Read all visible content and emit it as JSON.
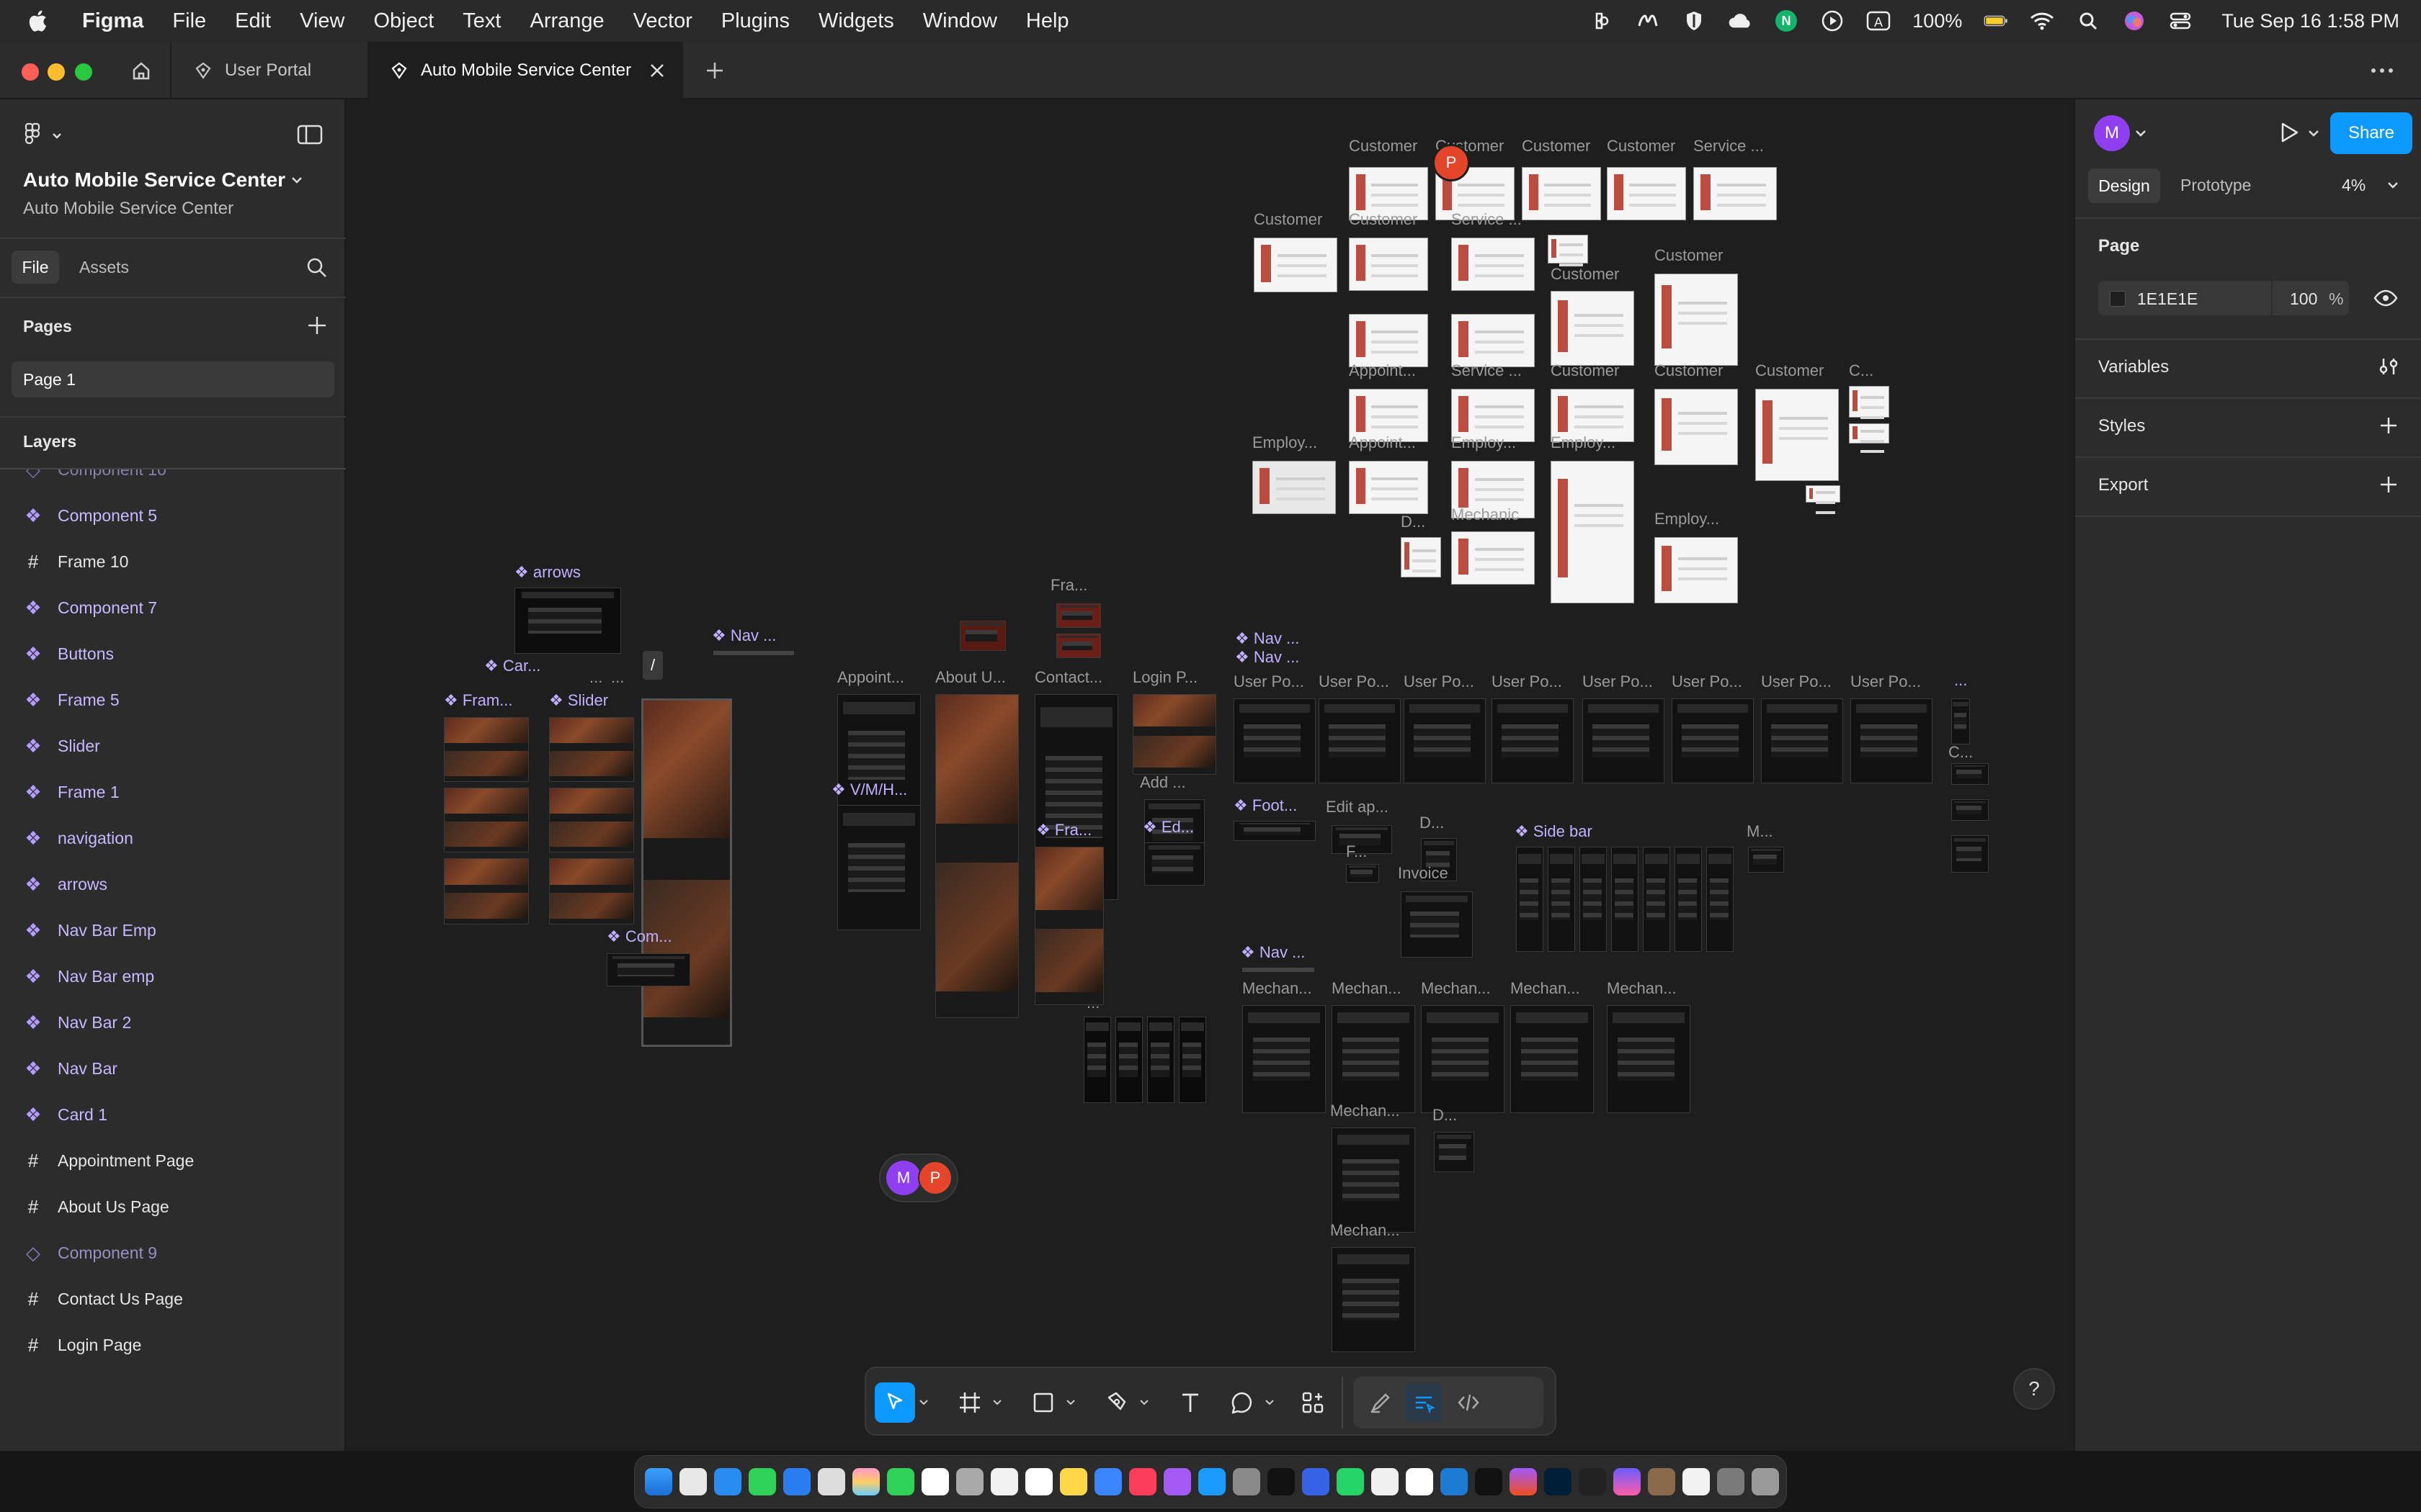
{
  "menubar": {
    "app_name": "Figma",
    "menus": [
      "File",
      "Edit",
      "View",
      "Object",
      "Text",
      "Arrange",
      "Vector",
      "Plugins",
      "Widgets",
      "Window",
      "Help"
    ],
    "battery": "100%",
    "datetime": "Tue Sep 16  1:58 PM"
  },
  "tabs": {
    "items": [
      {
        "label": "User Portal"
      },
      {
        "label": "Auto Mobile Service Center"
      }
    ]
  },
  "left_panel": {
    "file_title": "Auto Mobile Service Center",
    "file_subtitle": "Auto Mobile Service Center",
    "tab_file": "File",
    "tab_assets": "Assets",
    "pages_heading": "Pages",
    "current_page": "Page 1",
    "layers_heading": "Layers",
    "layers": [
      {
        "label": "Component 10",
        "kind": "component-ghost"
      },
      {
        "label": "Component 5",
        "kind": "component"
      },
      {
        "label": "Frame 10",
        "kind": "frame"
      },
      {
        "label": "Component 7",
        "kind": "component"
      },
      {
        "label": "Buttons",
        "kind": "component"
      },
      {
        "label": "Frame 5",
        "kind": "component"
      },
      {
        "label": "Slider",
        "kind": "component"
      },
      {
        "label": "Frame 1",
        "kind": "component"
      },
      {
        "label": "navigation",
        "kind": "component"
      },
      {
        "label": "arrows",
        "kind": "component"
      },
      {
        "label": "Nav Bar Emp",
        "kind": "component"
      },
      {
        "label": "Nav Bar emp",
        "kind": "component"
      },
      {
        "label": "Nav Bar 2",
        "kind": "component"
      },
      {
        "label": "Nav Bar",
        "kind": "component"
      },
      {
        "label": "Card 1",
        "kind": "component"
      },
      {
        "label": "Appointment  Page",
        "kind": "frame"
      },
      {
        "label": "About Us Page",
        "kind": "frame"
      },
      {
        "label": "Component 9",
        "kind": "component-ghost"
      },
      {
        "label": "Contact Us Page",
        "kind": "frame"
      },
      {
        "label": "Login Page",
        "kind": "frame"
      }
    ]
  },
  "right_panel": {
    "avatar_initial": "M",
    "share_label": "Share",
    "tab_design": "Design",
    "tab_prototype": "Prototype",
    "zoom": "4%",
    "page_heading": "Page",
    "page_color": "1E1E1E",
    "page_opacity": "100",
    "opacity_unit": "%",
    "variables_label": "Variables",
    "styles_label": "Styles",
    "export_label": "Export"
  },
  "canvas": {
    "frame_labels": {
      "customer": "Customer",
      "customer_alt": "Customer",
      "service": "Service ...",
      "appoint": "Appoint...",
      "employ": "Employ...",
      "employ2": "Employ...",
      "mechanic": "Mechanic",
      "c_short": "C...",
      "d_short": "D...",
      "f_short": "F...",
      "fra": "Fra...",
      "appointment": "Appoint...",
      "about": "About U...",
      "contact": "Contact...",
      "login": "Login P...",
      "user_portal": "User Po...",
      "edit_ap": "Edit ap...",
      "invoice": "Invoice",
      "add": "Add ...",
      "mechan": "Mechan...",
      "m_short": "M...",
      "ellipsis": "...",
      "slash": "/"
    },
    "component_labels": {
      "arrows": "arrows",
      "nav": "Nav ...",
      "card": "Car...",
      "frame": "Fram...",
      "slider": "Slider",
      "com": "Com...",
      "vmh": "V/M/H...",
      "fra": "Fra...",
      "ed": "Ed...",
      "foot": "Foot...",
      "side_bar": "Side bar"
    },
    "collaborators": [
      "M",
      "P"
    ],
    "cursor_initial": "P"
  },
  "colors": {
    "canvas_bg": "#1e1e1e",
    "panel_bg": "#2c2c2c",
    "accent_blue": "#0d99ff",
    "component_purple": "#c2b0ff",
    "collab_m": "#8f3ff0",
    "collab_p": "#e5462b"
  }
}
